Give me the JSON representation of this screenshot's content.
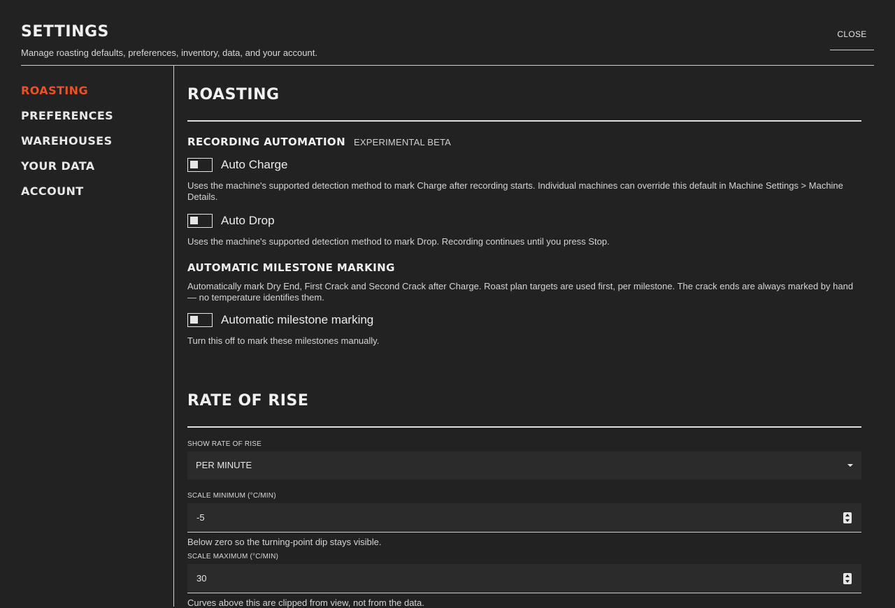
{
  "header": {
    "title": "SETTINGS",
    "subtitle": "Manage roasting defaults, preferences, inventory, data, and your account.",
    "close_label": "CLOSE"
  },
  "sidebar": {
    "items": [
      {
        "label": "ROASTING",
        "active": true
      },
      {
        "label": "PREFERENCES"
      },
      {
        "label": "WAREHOUSES"
      },
      {
        "label": "YOUR DATA"
      },
      {
        "label": "ACCOUNT"
      }
    ]
  },
  "roasting": {
    "title": "ROASTING",
    "recording_automation": {
      "title": "RECORDING AUTOMATION",
      "badge": "EXPERIMENTAL BETA",
      "auto_charge": {
        "label": "Auto Charge",
        "enabled": false,
        "description": "Uses the machine's supported detection method to mark Charge after recording starts. Individual machines can override this default in Machine Settings > Machine Details."
      },
      "auto_drop": {
        "label": "Auto Drop",
        "enabled": false,
        "description": "Uses the machine's supported detection method to mark Drop. Recording continues until you press Stop."
      }
    },
    "milestones": {
      "title": "AUTOMATIC MILESTONE MARKING",
      "description": "Automatically mark Dry End, First Crack and Second Crack after Charge. Roast plan targets are used first, per milestone. The crack ends are always marked by hand — no temperature identifies them.",
      "toggle_label": "Automatic milestone marking",
      "enabled": false,
      "helper": "Turn this off to mark these milestones manually."
    }
  },
  "rate_of_rise": {
    "title": "RATE OF RISE",
    "show_label": "SHOW RATE OF RISE",
    "show_value": "PER MINUTE",
    "scale_min_label": "SCALE MINIMUM (°C/MIN)",
    "scale_min_value": "-5",
    "scale_min_helper": "Below zero so the turning-point dip stays visible.",
    "scale_max_label": "SCALE MAXIMUM (°C/MIN)",
    "scale_max_value": "30",
    "scale_max_helper": "Curves above this are clipped from view, not from the data."
  },
  "colors": {
    "background": "#222222",
    "accent": "#e8512a",
    "field_bg": "#2b2b2b"
  }
}
